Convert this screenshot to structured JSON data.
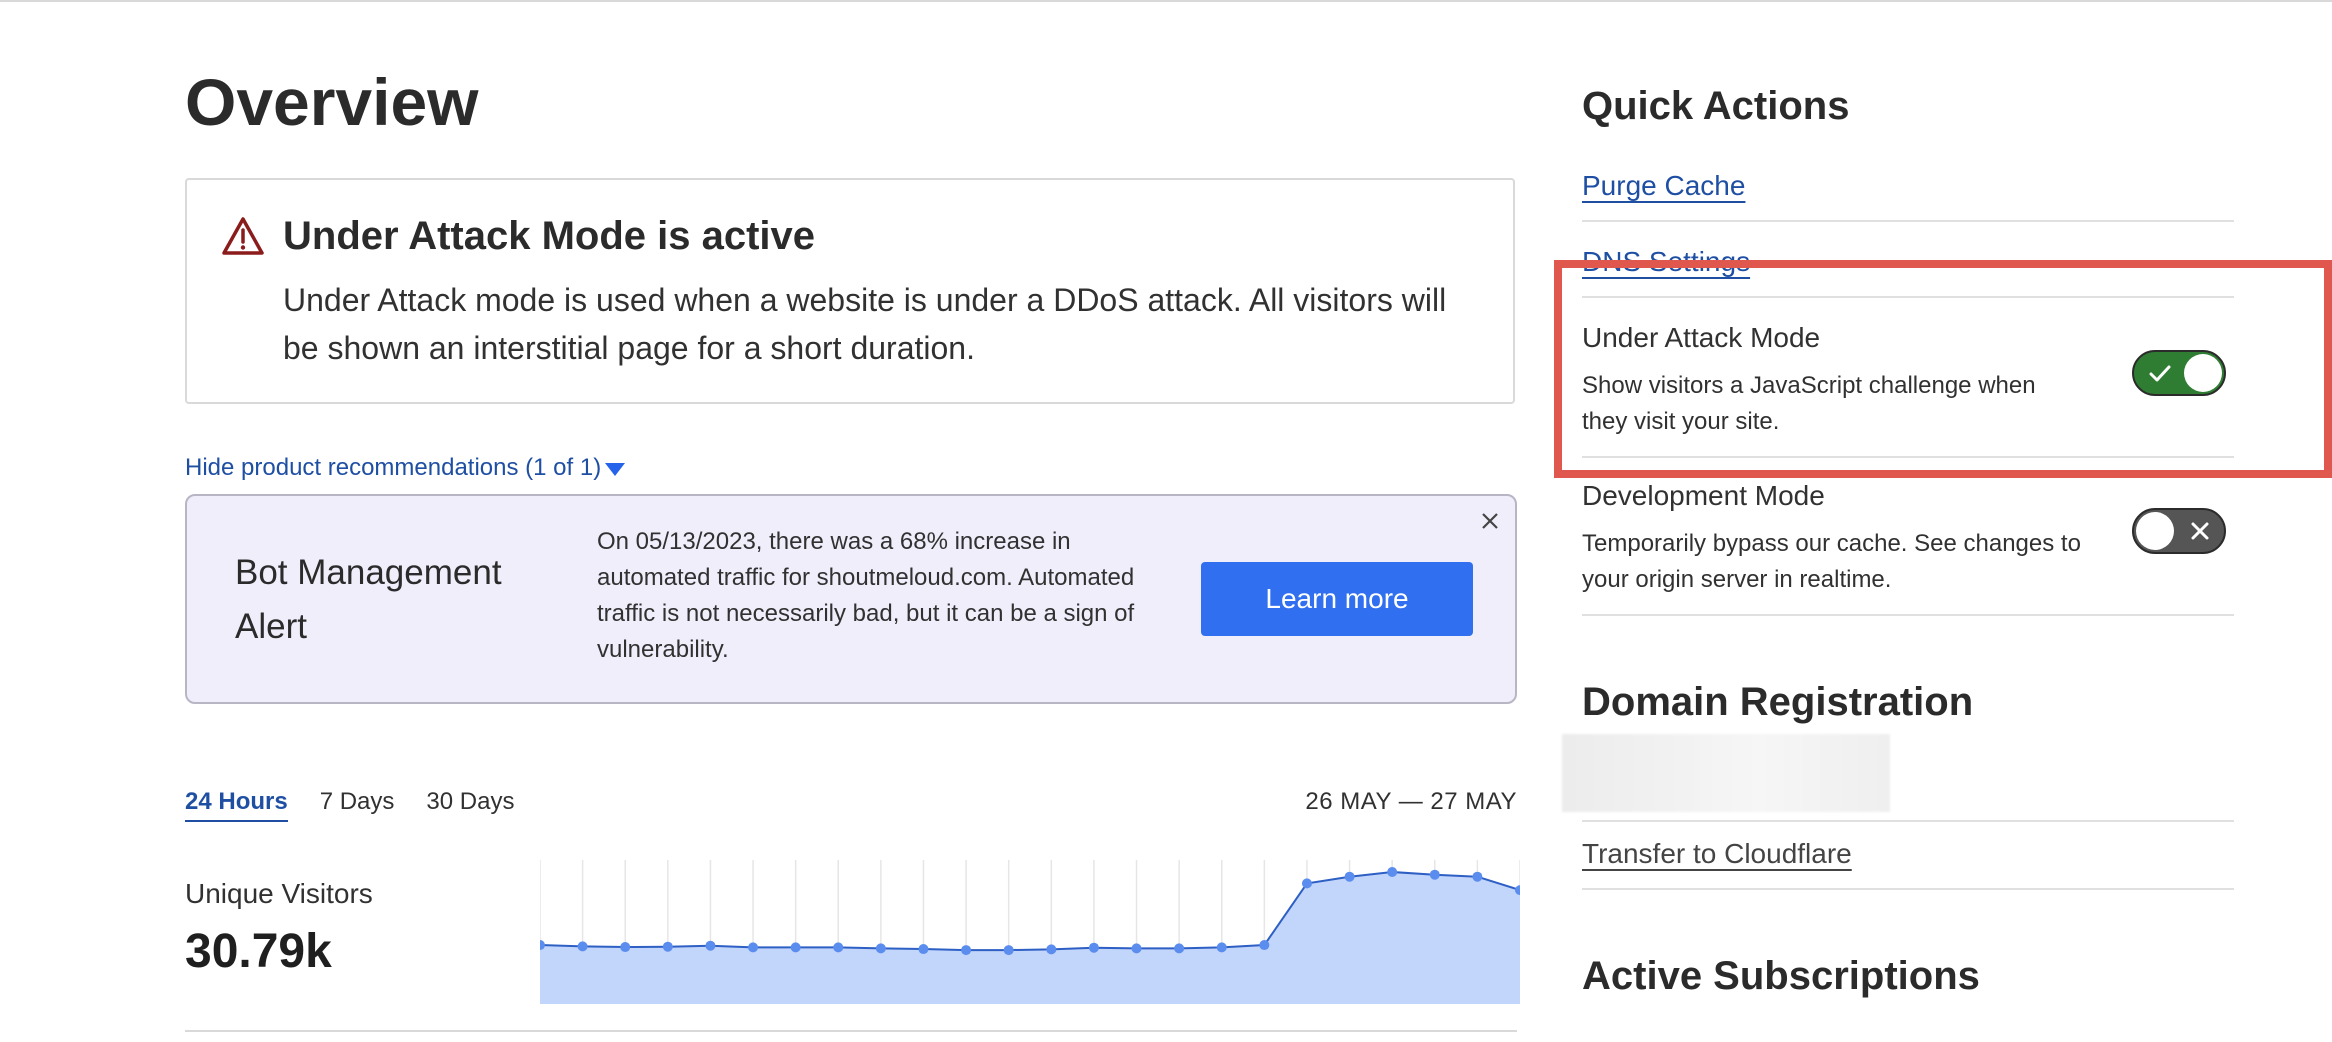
{
  "overview": {
    "title": "Overview",
    "attack_banner": {
      "title": "Under Attack Mode is active",
      "description": "Under Attack mode is used when a website is under a DDoS attack. All visitors will be shown an interstitial page for a short duration.",
      "icon": "warning-triangle-icon"
    },
    "recommendations_toggle": "Hide product recommendations (1 of 1)",
    "bot_card": {
      "title": "Bot Management Alert",
      "text": "On 05/13/2023, there was a 68% increase in automated traffic for shoutmeloud.com. Automated traffic is not necessarily bad, but it can be a sign of vulnerability.",
      "button": "Learn more"
    },
    "tabs": [
      "24 Hours",
      "7 Days",
      "30 Days"
    ],
    "active_tab": "24 Hours",
    "date_range": "26 MAY — 27 MAY",
    "metric": {
      "label": "Unique Visitors",
      "value": "30.79k"
    }
  },
  "chart_data": {
    "type": "area",
    "title": "",
    "xlabel": "",
    "ylabel": "",
    "values": [
      880,
      860,
      850,
      855,
      870,
      845,
      845,
      845,
      830,
      820,
      805,
      805,
      815,
      840,
      830,
      830,
      845,
      880,
      1800,
      1900,
      1970,
      1930,
      1900,
      1700
    ],
    "ylim": [
      0,
      2000
    ],
    "grid": "vertical",
    "color": "#5b8def",
    "fill": "#c2d5fa"
  },
  "sidebar": {
    "quick_actions_title": "Quick Actions",
    "purge_cache": "Purge Cache",
    "dns_settings": "DNS Settings",
    "under_attack": {
      "title": "Under Attack Mode",
      "description": "Show visitors a JavaScript challenge when they visit your site.",
      "state": "on"
    },
    "development_mode": {
      "title": "Development Mode",
      "description": "Temporarily bypass our cache. See changes to your origin server in realtime.",
      "state": "off"
    },
    "domain_registration_title": "Domain Registration",
    "transfer_link": "Transfer to Cloudflare",
    "active_subscriptions_title": "Active Subscriptions"
  },
  "colors": {
    "accent": "#2f6ff0",
    "link": "#1f4fa3",
    "highlight": "#e0584d",
    "toggle_on": "#2e7d32"
  }
}
